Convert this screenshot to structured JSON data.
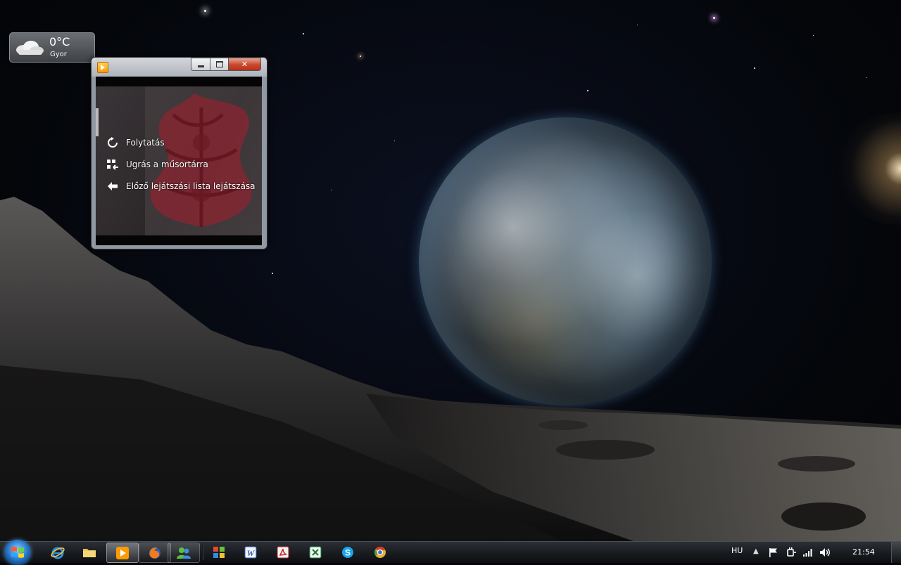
{
  "weather": {
    "temperature": "0°C",
    "city": "Gyor",
    "icon": "cloudy-weather-icon"
  },
  "media_player": {
    "app_icon": "windows-media-player-icon",
    "minimize_icon": "minimize-icon",
    "maximize_icon": "maximize-icon",
    "close_label": "✕",
    "menu": [
      {
        "label": "Folytatás",
        "icon": "resume-icon"
      },
      {
        "label": "Ugrás a műsortárra",
        "icon": "library-icon"
      },
      {
        "label": "Előző lejátszási lista lejátszása",
        "icon": "back-arrow-icon"
      }
    ]
  },
  "taskbar": {
    "start_icon": "windows-start-icon",
    "pinned": [
      {
        "name": "internet-explorer-icon",
        "state": "pinned"
      },
      {
        "name": "windows-explorer-icon",
        "state": "pinned"
      },
      {
        "name": "windows-media-player-icon",
        "state": "active"
      },
      {
        "name": "firefox-icon",
        "state": "open"
      },
      {
        "name": "windows-live-messenger-icon",
        "state": "open"
      },
      {
        "name": "microsoft-office-icon",
        "state": "pinned"
      },
      {
        "name": "microsoft-word-icon",
        "state": "pinned"
      },
      {
        "name": "acrobat-reader-icon",
        "state": "pinned"
      },
      {
        "name": "microsoft-excel-icon",
        "state": "pinned"
      },
      {
        "name": "skype-icon",
        "state": "pinned"
      },
      {
        "name": "chrome-icon",
        "state": "pinned"
      }
    ],
    "tray": {
      "language": "HU",
      "show_hidden_label": "▲",
      "icons": [
        "action-center-flag-icon",
        "power-plug-icon",
        "network-signal-icon",
        "volume-icon"
      ],
      "clock": "21:54"
    }
  }
}
